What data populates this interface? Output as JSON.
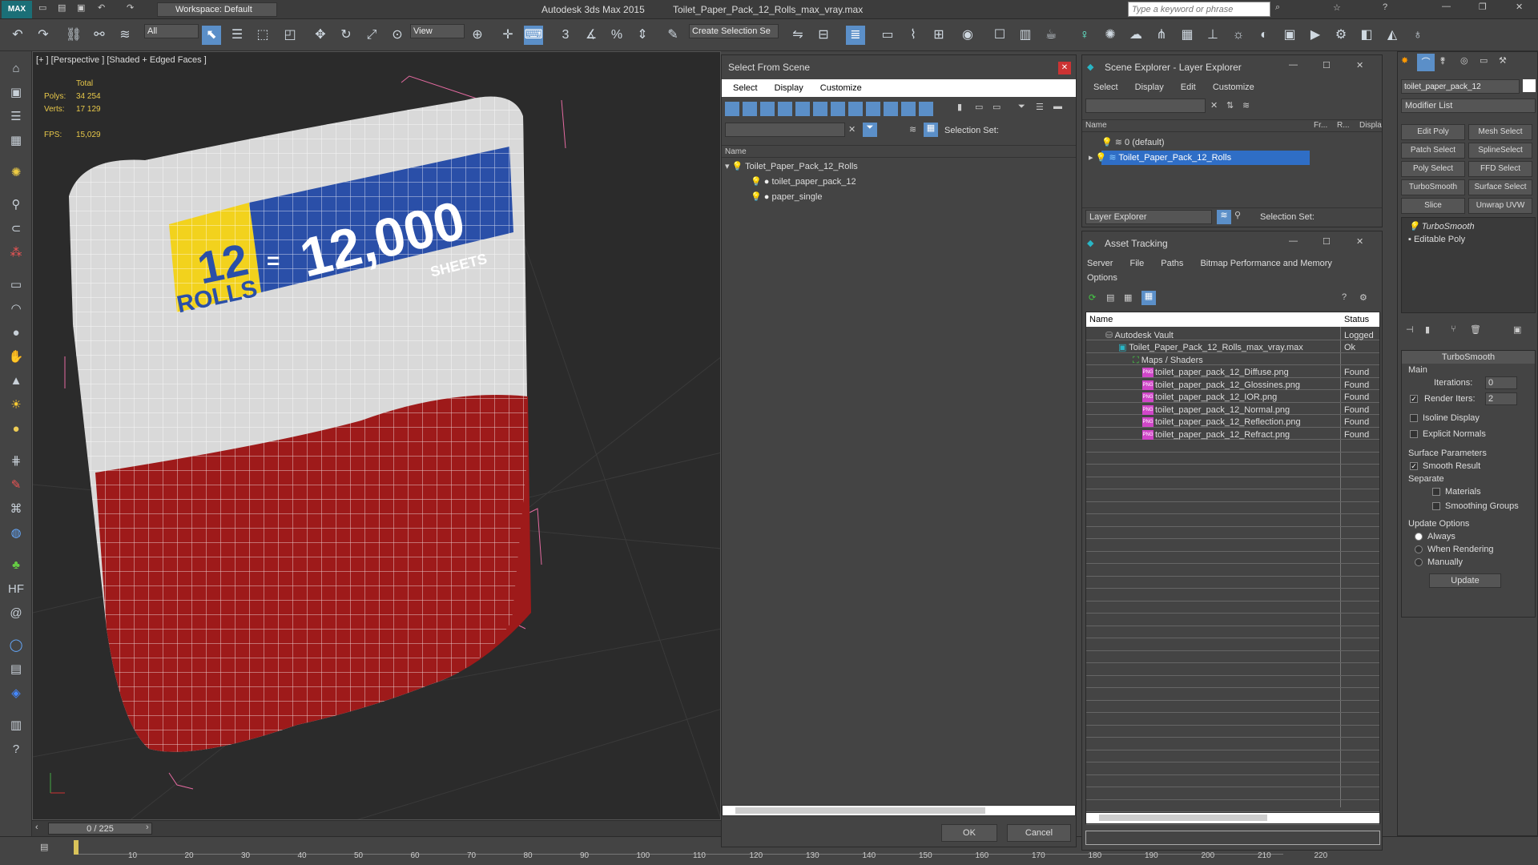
{
  "app": {
    "logo": "MAX",
    "title": "Autodesk 3ds Max  2015",
    "file": "Toilet_Paper_Pack_12_Rolls_max_vray.max",
    "workspace": "Workspace: Default",
    "search_placeholder": "Type a keyword or phrase"
  },
  "toolbar": {
    "filter": "All",
    "view": "View",
    "named_sel": "Create Selection Se"
  },
  "viewport": {
    "label": "[+ ] [Perspective ] [Shaded + Edged Faces ]",
    "stats_total": "Total",
    "polys_label": "Polys:",
    "polys": "34 254",
    "verts_label": "Verts:",
    "verts": "17 129",
    "fps_label": "FPS:",
    "fps": "15,029",
    "pack_rolls_num": "12",
    "pack_rolls": "ROLLS",
    "pack_eq": "=",
    "pack_sheets_num": "12,000",
    "pack_sheets": "SHEETS",
    "frame": "0 / 225",
    "ticks": [
      "10",
      "20",
      "30",
      "40",
      "50",
      "60",
      "70",
      "80",
      "90",
      "100",
      "110",
      "120",
      "130",
      "140",
      "150",
      "160",
      "170",
      "180",
      "190",
      "200",
      "210",
      "220"
    ]
  },
  "select_from_scene": {
    "title": "Select From Scene",
    "menu": [
      "Select",
      "Display",
      "Customize"
    ],
    "selection_set": "Selection Set:",
    "col_name": "Name",
    "items": [
      "Toilet_Paper_Pack_12_Rolls",
      "toilet_paper_pack_12",
      "paper_single"
    ],
    "ok": "OK",
    "cancel": "Cancel"
  },
  "scene_explorer": {
    "title": "Scene Explorer - Layer Explorer",
    "menu": [
      "Select",
      "Display",
      "Edit",
      "Customize"
    ],
    "cols": [
      "Name",
      "Fr...",
      "R...",
      "Displa..."
    ],
    "layers": [
      "0 (default)",
      "Toilet_Paper_Pack_12_Rolls"
    ],
    "footer_combo": "Layer Explorer",
    "selection_set": "Selection Set:"
  },
  "asset_tracking": {
    "title": "Asset Tracking",
    "menu": [
      "Server",
      "File",
      "Paths",
      "Bitmap Performance and Memory"
    ],
    "menu2": "Options",
    "col_name": "Name",
    "col_status": "Status",
    "rows": [
      {
        "name": "Autodesk Vault",
        "status": "Logged"
      },
      {
        "name": "Toilet_Paper_Pack_12_Rolls_max_vray.max",
        "status": "Ok"
      },
      {
        "name": "Maps / Shaders",
        "status": ""
      },
      {
        "name": "toilet_paper_pack_12_Diffuse.png",
        "status": "Found"
      },
      {
        "name": "toilet_paper_pack_12_Glossines.png",
        "status": "Found"
      },
      {
        "name": "toilet_paper_pack_12_IOR.png",
        "status": "Found"
      },
      {
        "name": "toilet_paper_pack_12_Normal.png",
        "status": "Found"
      },
      {
        "name": "toilet_paper_pack_12_Reflection.png",
        "status": "Found"
      },
      {
        "name": "toilet_paper_pack_12_Refract.png",
        "status": "Found"
      }
    ]
  },
  "command_panel": {
    "object_name": "toilet_paper_pack_12",
    "modifier_list": "Modifier List",
    "mod_buttons": [
      "Edit Poly",
      "Mesh Select",
      "Patch Select",
      "SplineSelect",
      "Poly Select",
      "FFD Select",
      "TurboSmooth",
      "Surface Select",
      "Slice",
      "Unwrap UVW"
    ],
    "stack": [
      "TurboSmooth",
      "Editable Poly"
    ],
    "rollout": "TurboSmooth",
    "main": "Main",
    "iterations_label": "Iterations:",
    "iterations": "0",
    "render_iters_label": "Render Iters:",
    "render_iters": "2",
    "isoline": "Isoline Display",
    "explicit": "Explicit Normals",
    "surface_params": "Surface Parameters",
    "smooth_result": "Smooth Result",
    "separate": "Separate",
    "materials": "Materials",
    "smoothing_groups": "Smoothing Groups",
    "update_options": "Update Options",
    "always": "Always",
    "when_rendering": "When Rendering",
    "manually": "Manually",
    "update": "Update"
  }
}
